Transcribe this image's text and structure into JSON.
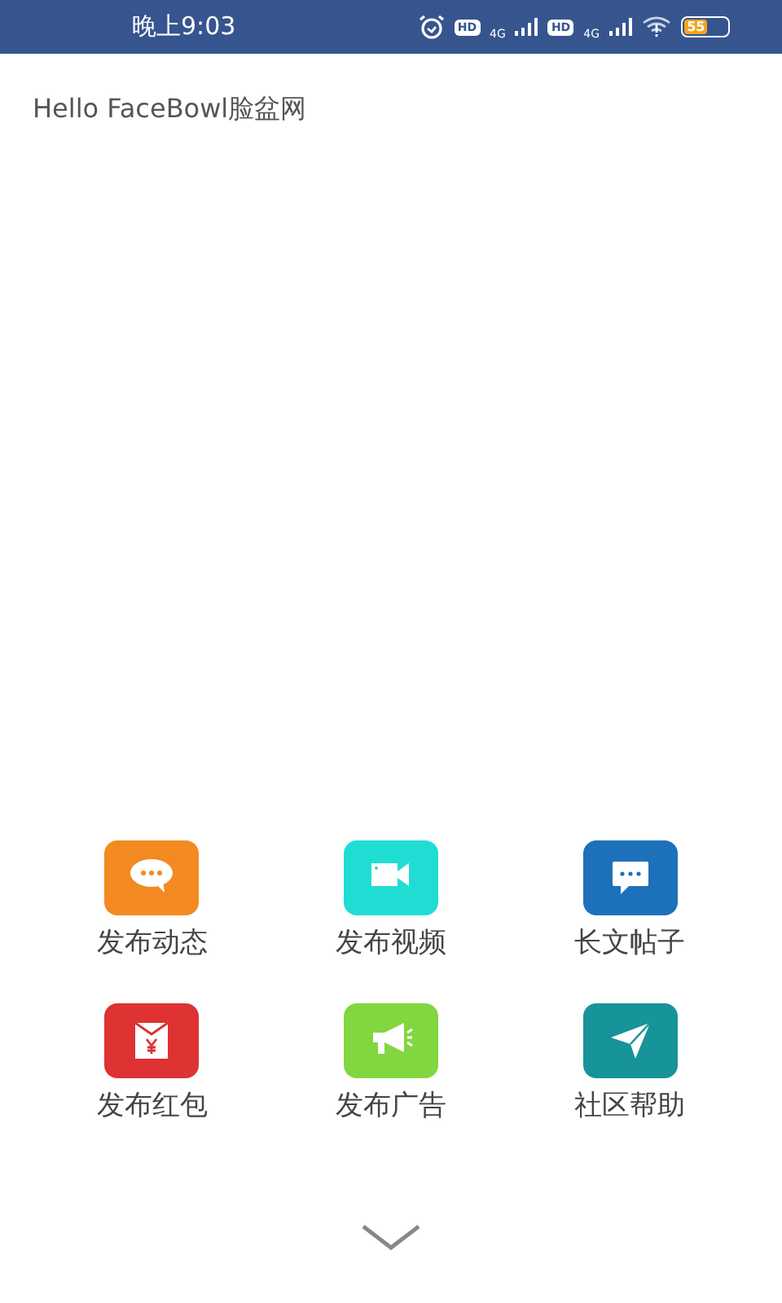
{
  "status_bar": {
    "time": "晚上9:03",
    "sim_1": {
      "hd": "HD",
      "network": "4G"
    },
    "sim_2": {
      "hd": "HD",
      "network": "4G"
    },
    "battery": "55"
  },
  "greeting": "Hello FaceBowl脸盆网",
  "actions": [
    {
      "label": "发布动态",
      "color": "#f28a21",
      "kind": "chat"
    },
    {
      "label": "发布视频",
      "color": "#20ddd4",
      "kind": "video"
    },
    {
      "label": "长文帖子",
      "color": "#1d71ba",
      "kind": "message"
    },
    {
      "label": "发布红包",
      "color": "#de3233",
      "kind": "envelope"
    },
    {
      "label": "发布广告",
      "color": "#82d63f",
      "kind": "megaphone"
    },
    {
      "label": "社区帮助",
      "color": "#17939a",
      "kind": "send"
    }
  ]
}
